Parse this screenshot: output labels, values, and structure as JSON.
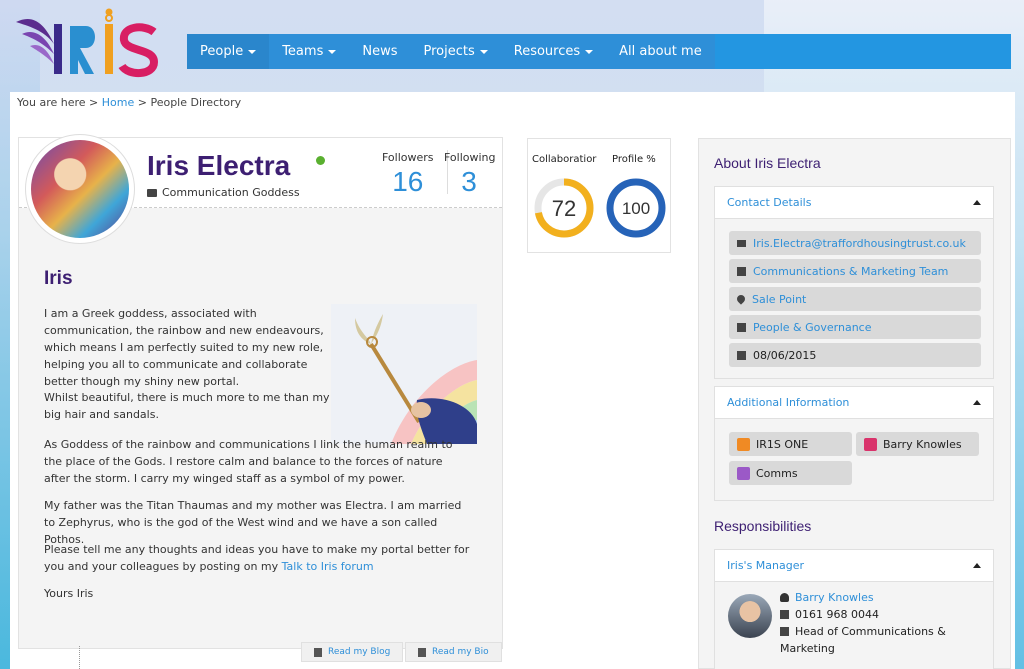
{
  "brand": {
    "logo_text": "IRIS",
    "accent": "#2e8fd8",
    "title_color": "#3d1f72"
  },
  "nav": {
    "items": [
      {
        "label": "People",
        "has_dropdown": true,
        "active": true
      },
      {
        "label": "Teams",
        "has_dropdown": true
      },
      {
        "label": "News",
        "has_dropdown": false
      },
      {
        "label": "Projects",
        "has_dropdown": true
      },
      {
        "label": "Resources",
        "has_dropdown": true
      },
      {
        "label": "All about me",
        "has_dropdown": false
      }
    ]
  },
  "breadcrumb": {
    "prefix": "You are here >",
    "home": "Home",
    "separator": ">",
    "current": "People Directory"
  },
  "profile": {
    "name": "Iris Electra",
    "status": "online",
    "job_title": "Communication Goddess",
    "followers_label": "Followers",
    "followers": "16",
    "following_label": "Following",
    "following": "3",
    "bio_title": "Iris",
    "bio": [
      "I am a Greek goddess, associated with communication, the rainbow and new endeavours, which means I am perfectly suited to my new role, helping you all to communicate and collaborate better though my shiny new portal.",
      "Whilst beautiful, there is much more to me than my big hair and sandals.",
      "As Goddess of the rainbow and communications I link the human realm to the place of the Gods. I restore calm and balance to the forces of nature after the storm. I carry my winged staff as a symbol of my power.",
      "My father was the Titan Thaumas and my mother was Electra. I am married to Zephyrus, who is the god of the West wind and we have a son called Pothos.",
      "Please tell me any thoughts and ideas you have to make my portal better for you and your colleagues by posting on my",
      "Yours Iris"
    ],
    "forum_link": "Talk to Iris forum",
    "read_blog": "Read my Blog",
    "read_bio": "Read my Bio"
  },
  "stats": {
    "collaboration_label": "Collaboratior",
    "collaboration_value": "72",
    "profile_label": "Profile %",
    "profile_value": "100"
  },
  "about": {
    "title": "About Iris Electra",
    "contact_header": "Contact Details",
    "email": "Iris.Electra@traffordhousingtrust.co.uk",
    "team": "Communications & Marketing Team",
    "location": "Sale Point",
    "department": "People & Governance",
    "date": "08/06/2015",
    "additional_header": "Additional Information",
    "tags": [
      "IR1S ONE",
      "Barry Knowles",
      "Comms"
    ]
  },
  "responsibilities": {
    "title": "Responsibilities",
    "manager_header": "Iris's Manager",
    "manager_name": "Barry Knowles",
    "manager_phone": "0161 968 0044",
    "manager_role_line1": "Head of Communications &",
    "manager_role_line2": "Marketing"
  }
}
